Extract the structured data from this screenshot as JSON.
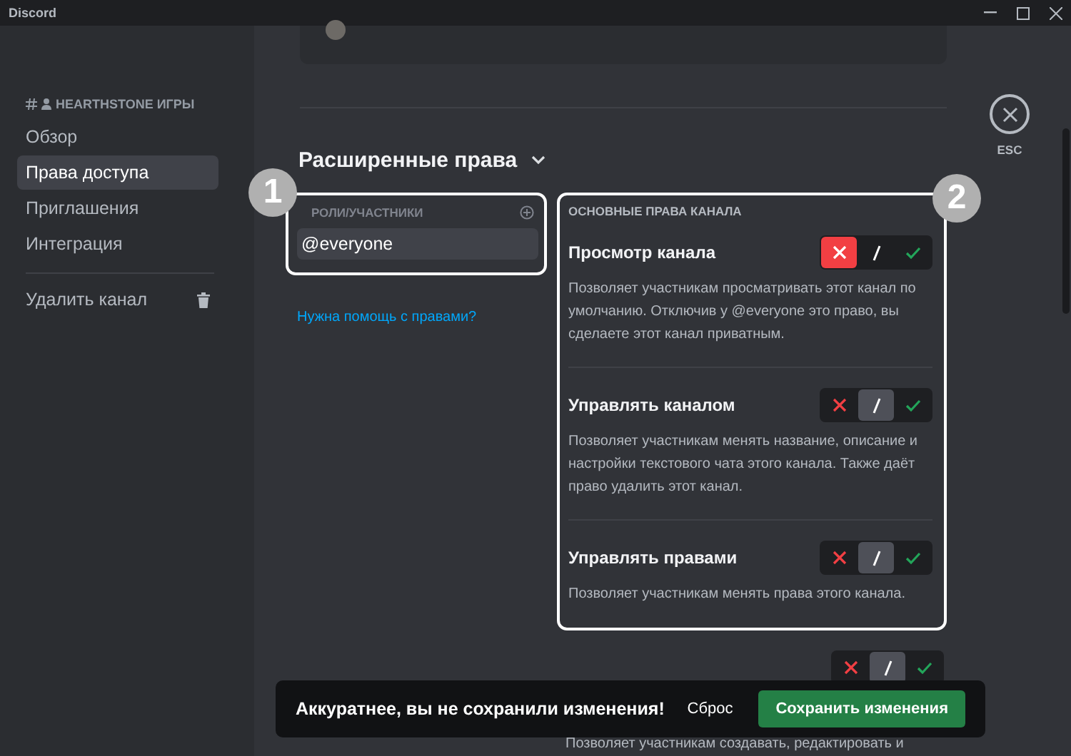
{
  "window": {
    "title": "Discord"
  },
  "sidebar": {
    "header": "HEARTHSTONE ИГРЫ",
    "items": [
      {
        "label": "Обзор",
        "selected": false
      },
      {
        "label": "Права доступа",
        "selected": true
      },
      {
        "label": "Приглашения",
        "selected": false
      },
      {
        "label": "Интеграция",
        "selected": false
      }
    ],
    "delete_label": "Удалить канал"
  },
  "close": {
    "label": "ESC"
  },
  "section": {
    "title": "Расширенные права",
    "expanded": true
  },
  "roles": {
    "header": "РОЛИ/УЧАСТНИКИ",
    "items": [
      {
        "label": "@everyone",
        "selected": true
      }
    ],
    "help_link": "Нужна помощь с правами?"
  },
  "permissions": {
    "header": "ОСНОВНЫЕ ПРАВА КАНАЛА",
    "items": [
      {
        "title": "Просмотр канала",
        "toggles": [
          {
            "kind": "deny",
            "selected": true
          },
          {
            "kind": "neutral",
            "selected": false
          },
          {
            "kind": "allow",
            "selected": false
          }
        ],
        "description": "Позволяет участникам просматривать этот канал по умолчанию. Отключив у @everyone это право, вы сделаете этот канал приватным."
      },
      {
        "title": "Управлять каналом",
        "toggles": [
          {
            "kind": "deny",
            "selected": false
          },
          {
            "kind": "neutral",
            "selected": true
          },
          {
            "kind": "allow",
            "selected": false
          }
        ],
        "description": "Позволяет участникам менять название, описание и настройки текстового чата этого канала. Также даёт право удалить этот канал."
      },
      {
        "title": "Управлять правами",
        "toggles": [
          {
            "kind": "deny",
            "selected": false
          },
          {
            "kind": "neutral",
            "selected": true
          },
          {
            "kind": "allow",
            "selected": false
          }
        ],
        "description": "Позволяет участникам менять права этого канала."
      },
      {
        "toggles": [
          {
            "kind": "deny",
            "selected": false
          },
          {
            "kind": "neutral",
            "selected": true
          },
          {
            "kind": "allow",
            "selected": false
          }
        ],
        "description": "Позволяет участникам создавать, редактировать и"
      }
    ]
  },
  "callouts": [
    "1",
    "2"
  ],
  "toast": {
    "message": "Аккуратнее, вы не сохранили изменения!",
    "reset": "Сброс",
    "save": "Сохранить изменения"
  }
}
